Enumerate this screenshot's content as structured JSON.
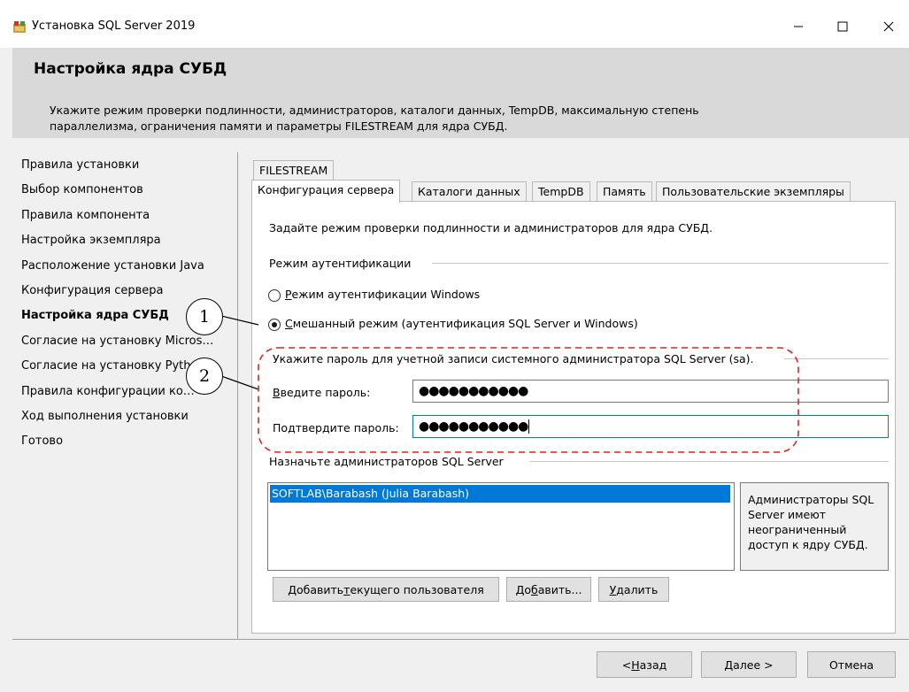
{
  "window": {
    "title": "Установка SQL Server 2019",
    "minimize_glyph": "—",
    "maximize_glyph": "☐",
    "close_glyph": "✕",
    "icon": "sql-setup-icon"
  },
  "header": {
    "title": "Настройка ядра СУБД",
    "description": "Укажите режим проверки подлинности, администраторов, каталоги данных, TempDB, максимальную степень параллелизма, ограничения памяти и параметры FILESTREAM для ядра СУБД."
  },
  "steps": [
    {
      "label": "Правила установки",
      "active": false
    },
    {
      "label": "Выбор компонентов",
      "active": false
    },
    {
      "label": "Правила компонента",
      "active": false
    },
    {
      "label": "Настройка экземпляра",
      "active": false
    },
    {
      "label": "Расположение установки Java",
      "active": false
    },
    {
      "label": "Конфигурация сервера",
      "active": false
    },
    {
      "label": "Настройка ядра СУБД",
      "active": true
    },
    {
      "label": "Согласие на установку Micros…",
      "active": false
    },
    {
      "label": "Согласие на установку Pyth…",
      "active": false
    },
    {
      "label": "Правила конфигурации ко…",
      "active": false
    },
    {
      "label": "Ход выполнения установки",
      "active": false
    },
    {
      "label": "Готово",
      "active": false
    }
  ],
  "tabs": {
    "row1": [
      "FILESTREAM"
    ],
    "row2": [
      "Конфигурация сервера",
      "Каталоги данных",
      "TempDB",
      "Память",
      "Пользовательские экземпляры"
    ],
    "active": "Конфигурация сервера"
  },
  "panel": {
    "intro": "Задайте режим проверки подлинности и администраторов для ядра СУБД.",
    "auth_group": "Режим аутентификации",
    "radio_windows": {
      "underline": "Р",
      "rest": "ежим аутентификации Windows",
      "selected": false
    },
    "radio_mixed": {
      "underline": "С",
      "rest": "мешанный режим (аутентификация SQL Server и Windows)",
      "selected": true
    },
    "password_group": "Укажите пароль для учетной записи системного администратора SQL Server (sa).",
    "password_label": {
      "underline": "В",
      "rest": "ведите пароль:"
    },
    "password_value": "●●●●●●●●●●●",
    "confirm_label": {
      "pre": "По",
      "underline": "д",
      "rest": "твердите пароль:"
    },
    "confirm_value": "●●●●●●●●●●●",
    "admins_group": "Назначьте администраторов SQL Server",
    "admins": [
      "SOFTLAB\\Barabash (Julia Barabash)"
    ],
    "admins_info": "Администраторы SQL Server имеют неограниченный доступ к ядру СУБД.",
    "btn_add_current": {
      "pre": "Добавить ",
      "underline": "т",
      "rest": "екущего пользователя"
    },
    "btn_add": {
      "pre": "До",
      "underline": "б",
      "rest": "авить..."
    },
    "btn_remove": {
      "pre": "",
      "underline": "У",
      "rest": "далить"
    }
  },
  "footer": {
    "back": {
      "pre": "< ",
      "underline": "Н",
      "rest": "азад"
    },
    "next": {
      "pre": "",
      "underline": "Д",
      "rest": "алее >"
    },
    "cancel": "Отмена"
  },
  "callouts": {
    "one": "1",
    "two": "2"
  },
  "colors": {
    "accent": "#0078d7",
    "header_bg": "#d9d9d9",
    "callout_dash": "#d9261c"
  }
}
